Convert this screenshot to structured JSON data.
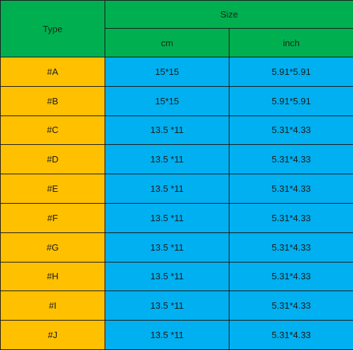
{
  "table": {
    "header": {
      "type_label": "Type",
      "size_label": "Size",
      "cm_label": "cm",
      "inch_label": "inch"
    },
    "rows": [
      {
        "type": "#A",
        "cm": "15*15",
        "inch": "5.91*5.91"
      },
      {
        "type": "#B",
        "cm": "15*15",
        "inch": "5.91*5.91"
      },
      {
        "type": "#C",
        "cm": "13.5 *11",
        "inch": "5.31*4.33"
      },
      {
        "type": "#D",
        "cm": "13.5 *11",
        "inch": "5.31*4.33"
      },
      {
        "type": "#E",
        "cm": "13.5 *11",
        "inch": "5.31*4.33"
      },
      {
        "type": "#F",
        "cm": "13.5 *11",
        "inch": "5.31*4.33"
      },
      {
        "type": "#G",
        "cm": "13.5 *11",
        "inch": "5.31*4.33"
      },
      {
        "type": "#H",
        "cm": "13.5 *11",
        "inch": "5.31*4.33"
      },
      {
        "type": "#I",
        "cm": "13.5 *11",
        "inch": "5.31*4.33"
      },
      {
        "type": "#J",
        "cm": "13.5 *11",
        "inch": "5.31*4.33"
      }
    ],
    "colors": {
      "header_bg": "#00b050",
      "type_bg": "#ffc000",
      "size_bg": "#00b0f0"
    }
  }
}
